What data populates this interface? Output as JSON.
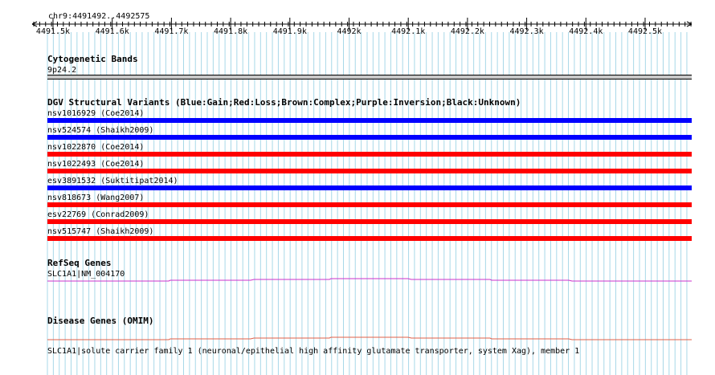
{
  "ruler": {
    "range_label": "chr9:4491492..4492575",
    "ticks": [
      "4491.5k",
      "4491.6k",
      "4491.7k",
      "4491.8k",
      "4491.9k",
      "4492k",
      "4492.1k",
      "4492.2k",
      "4492.3k",
      "4492.4k",
      "4492.5k"
    ]
  },
  "cytoband": {
    "title": "Cytogenetic Bands",
    "band": "9p24.2"
  },
  "dgv": {
    "title": "DGV Structural Variants (Blue:Gain;Red:Loss;Brown:Complex;Purple:Inversion;Black:Unknown)",
    "colors": {
      "gain": "#0000ff",
      "loss": "#ff0000"
    },
    "variants": [
      {
        "label": "nsv1016929 (Coe2014)",
        "type": "gain"
      },
      {
        "label": "nsv524574 (Shaikh2009)",
        "type": "gain"
      },
      {
        "label": "nsv1022870 (Coe2014)",
        "type": "loss"
      },
      {
        "label": "nsv1022493 (Coe2014)",
        "type": "loss"
      },
      {
        "label": "esv3891532 (Suktitipat2014)",
        "type": "gain"
      },
      {
        "label": "nsv818673 (Wang2007)",
        "type": "loss"
      },
      {
        "label": "esv22769 (Conrad2009)",
        "type": "loss"
      },
      {
        "label": "nsv515747 (Shaikh2009)",
        "type": "loss"
      }
    ]
  },
  "refseq": {
    "title": "RefSeq Genes",
    "gene": "SLC1A1|NM_004170",
    "color": "#cc33cc"
  },
  "omim": {
    "title": "Disease Genes (OMIM)",
    "gene": "SLC1A1|solute carrier family 1 (neuronal/epithelial high affinity glutamate transporter, system Xag), member 1",
    "color": "#e0604a"
  },
  "grid_color": "#a8d8e8"
}
